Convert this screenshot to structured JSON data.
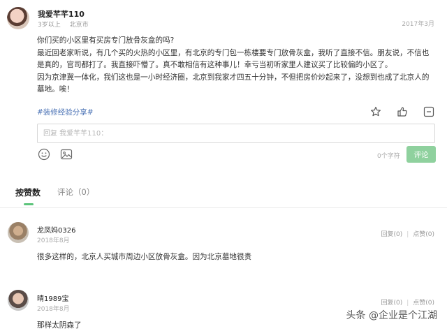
{
  "post": {
    "author": "我爱芊芊110",
    "meta_age": "3岁以上",
    "meta_city": "北京市",
    "date": "2017年3月",
    "paragraphs": [
      "你们买的小区里有买房专门放骨灰盒的吗?",
      "最近回老家听说，有几个买的火热的小区里，有北京的专门包一栋楼要专门放骨灰盒，我听了直接不信。朋友说，不信也是真的，官司都打了。我直接吓懵了。真不敢相信有这种事儿！幸亏当初听家里人建议买了比较偏的小区了。",
      "因为京津冀一体化，我们这也是一小时经济圈，北京到我家才四五十分钟，不但把房价炒起来了，没想到也成了北京人的墓地。唉！"
    ],
    "tag": "#装修经验分享#",
    "icons": [
      "star-icon",
      "like-icon",
      "dislike-icon"
    ]
  },
  "reply": {
    "placeholder": "回复 我爱芊芊110：",
    "char_count": "0个字符",
    "submit_label": "评论",
    "tool_icons": [
      "emoji-icon",
      "image-icon"
    ]
  },
  "tabs": {
    "likes": "按赞数",
    "comments": "评论（0）"
  },
  "comments": [
    {
      "name": "龙凤妈0326",
      "date": "2018年8月",
      "reply": "回复(0)",
      "like": "点赞(0)",
      "text": "很多这样的，北京人买城市周边小区放骨灰盒。因为北京墓地很贵"
    },
    {
      "name": "晴1989宝",
      "date": "2018年8月",
      "reply": "回复(0)",
      "like": "点赞(0)",
      "text": "那样太阴森了"
    }
  ],
  "watermark": "头条 @企业是个江湖",
  "colors": {
    "accent_green": "#5cc47b",
    "submit_green": "#8fd19e",
    "tag_blue": "#4a72b5"
  }
}
